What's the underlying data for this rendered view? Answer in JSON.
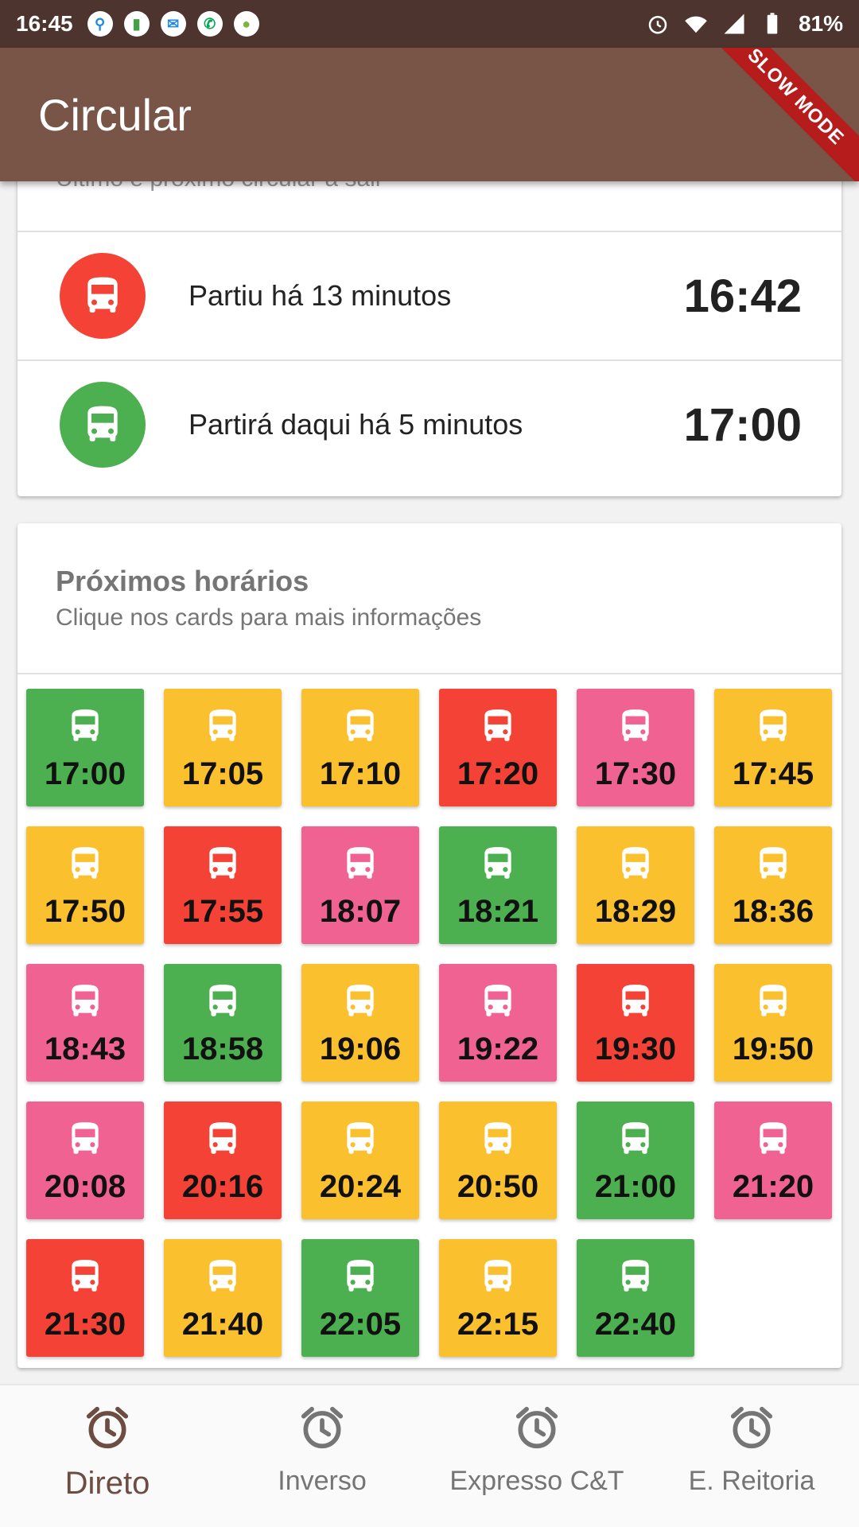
{
  "status_bar": {
    "time": "16:45",
    "battery": "81%",
    "notification_icons": [
      "usb-icon",
      "battery-saver-icon",
      "messenger-icon",
      "call-icon",
      "android-icon"
    ],
    "ribbon": "SLOW MODE"
  },
  "app_bar": {
    "title": "Circular"
  },
  "top_card": {
    "cut_text": "Último e próximo circular a sair",
    "rows": [
      {
        "text": "Partiu há 13 minutos",
        "time": "16:42",
        "color": "#f44336",
        "icon": "bus-icon"
      },
      {
        "text": "Partirá daqui há 5 minutos",
        "time": "17:00",
        "color": "#4caf50",
        "icon": "bus-icon"
      }
    ]
  },
  "schedule": {
    "title": "Próximos horários",
    "subtitle": "Clique nos cards para mais informações",
    "colors": {
      "green": "#4caf50",
      "yellow": "#fbc02d",
      "red": "#f44336",
      "pink": "#f06292"
    },
    "tiles": [
      {
        "time": "17:00",
        "color": "green"
      },
      {
        "time": "17:05",
        "color": "yellow"
      },
      {
        "time": "17:10",
        "color": "yellow"
      },
      {
        "time": "17:20",
        "color": "red"
      },
      {
        "time": "17:30",
        "color": "pink"
      },
      {
        "time": "17:45",
        "color": "yellow"
      },
      {
        "time": "17:50",
        "color": "yellow"
      },
      {
        "time": "17:55",
        "color": "red"
      },
      {
        "time": "18:07",
        "color": "pink"
      },
      {
        "time": "18:21",
        "color": "green"
      },
      {
        "time": "18:29",
        "color": "yellow"
      },
      {
        "time": "18:36",
        "color": "yellow"
      },
      {
        "time": "18:43",
        "color": "pink"
      },
      {
        "time": "18:58",
        "color": "green"
      },
      {
        "time": "19:06",
        "color": "yellow"
      },
      {
        "time": "19:22",
        "color": "pink"
      },
      {
        "time": "19:30",
        "color": "red"
      },
      {
        "time": "19:50",
        "color": "yellow"
      },
      {
        "time": "20:08",
        "color": "pink"
      },
      {
        "time": "20:16",
        "color": "red"
      },
      {
        "time": "20:24",
        "color": "yellow"
      },
      {
        "time": "20:50",
        "color": "yellow"
      },
      {
        "time": "21:00",
        "color": "green"
      },
      {
        "time": "21:20",
        "color": "pink"
      },
      {
        "time": "21:30",
        "color": "red"
      },
      {
        "time": "21:40",
        "color": "yellow"
      },
      {
        "time": "22:05",
        "color": "green"
      },
      {
        "time": "22:15",
        "color": "yellow"
      },
      {
        "time": "22:40",
        "color": "green"
      }
    ]
  },
  "bottom_nav": {
    "items": [
      {
        "label": "Direto",
        "icon": "alarm-clock-icon",
        "active": true
      },
      {
        "label": "Inverso",
        "icon": "alarm-clock-icon",
        "active": false
      },
      {
        "label": "Expresso C&T",
        "icon": "alarm-clock-icon",
        "active": false
      },
      {
        "label": "E. Reitoria",
        "icon": "alarm-clock-icon",
        "active": false
      }
    ]
  }
}
